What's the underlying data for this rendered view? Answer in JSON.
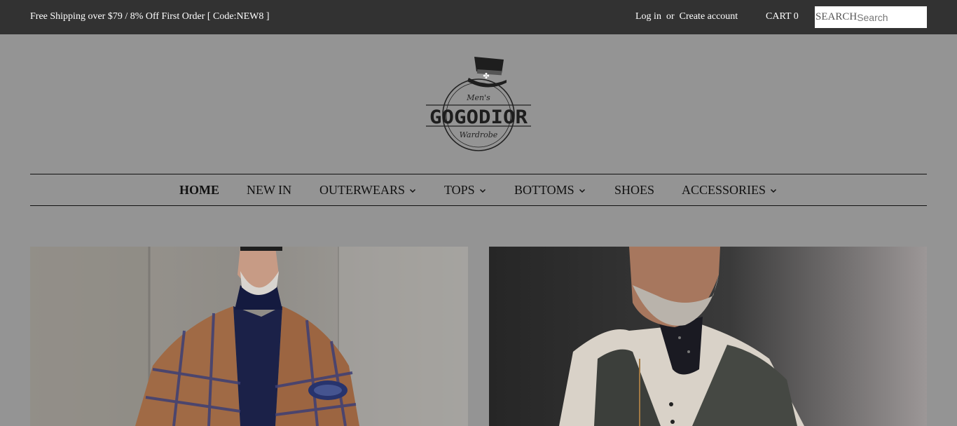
{
  "topbar": {
    "promo": "Free Shipping over $79 / 8% Off First Order [ Code:NEW8 ]",
    "login": "Log in",
    "or": "or",
    "create_account": "Create account",
    "cart": "CART 0",
    "search_label": "SEARCH",
    "search_placeholder": "Search"
  },
  "logo": {
    "top_text": "Men's",
    "brand": "GOGODIOR",
    "bottom_text": "Wardrobe"
  },
  "nav": {
    "items": [
      {
        "label": "HOME",
        "dropdown": false
      },
      {
        "label": "NEW IN",
        "dropdown": false
      },
      {
        "label": "OUTERWEARS",
        "dropdown": true
      },
      {
        "label": "TOPS",
        "dropdown": true
      },
      {
        "label": "BOTTOMS",
        "dropdown": true
      },
      {
        "label": "SHOES",
        "dropdown": false
      },
      {
        "label": "ACCESSORIES",
        "dropdown": true
      }
    ]
  },
  "colors": {
    "topbar_bg": "#323232",
    "page_bg": "#949494",
    "text_dark": "#111111"
  },
  "icons": {
    "dropdown": "chevron-down-icon",
    "logo_hat": "top-hat-icon"
  }
}
